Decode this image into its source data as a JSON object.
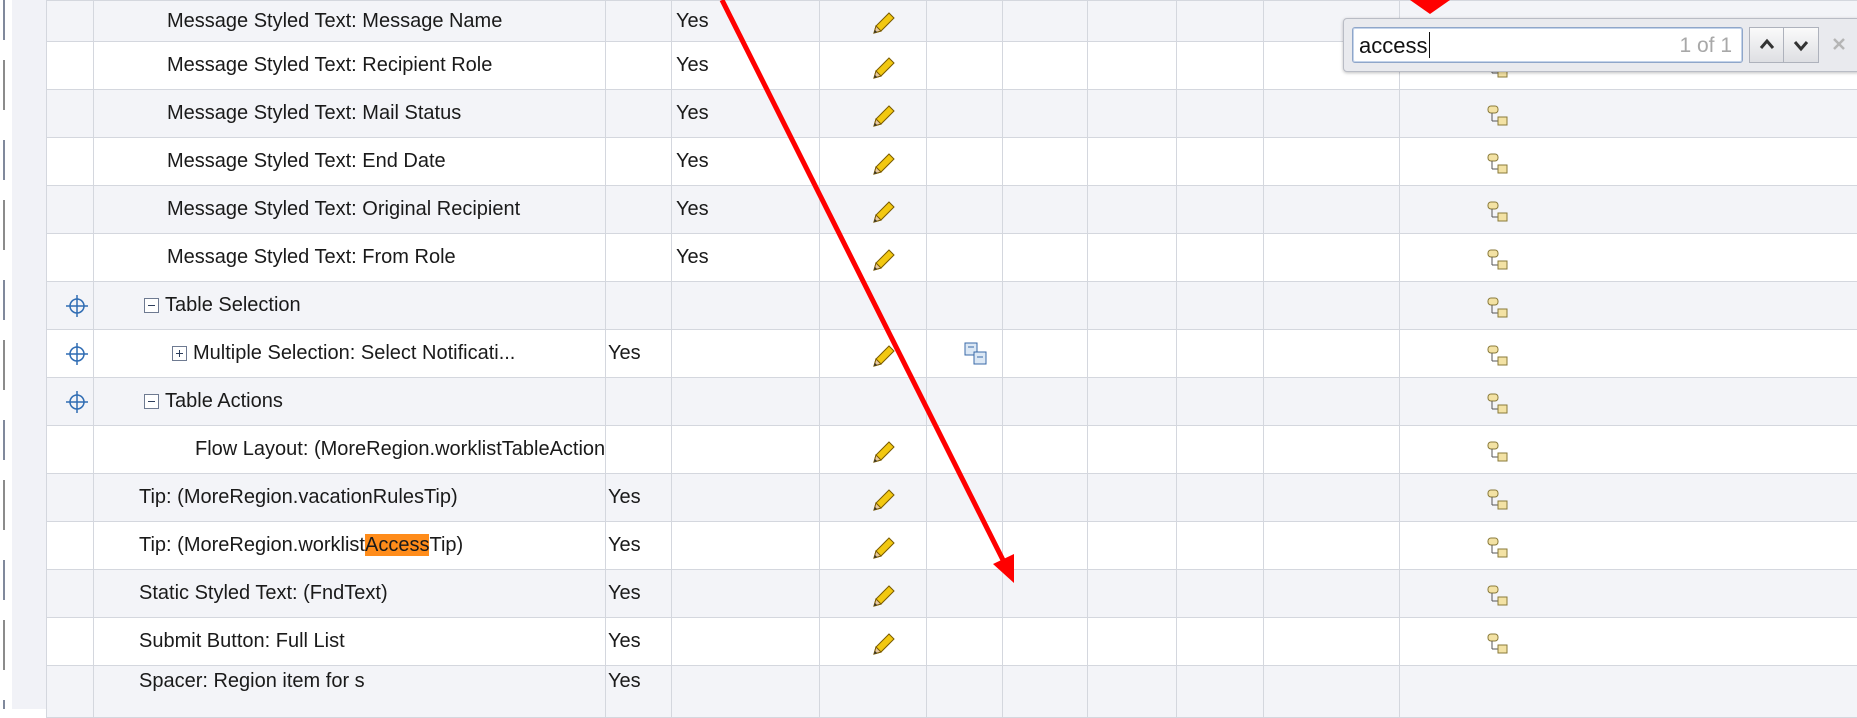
{
  "find": {
    "query": "access",
    "count": "1 of 1",
    "prev_icon": "chevron-up-icon",
    "next_icon": "chevron-down-icon",
    "close_icon": "close-icon"
  },
  "colors": {
    "match_highlight": "#ff8c1a",
    "arrow": "#ff0000",
    "row_alt": "#f3f4f8"
  },
  "rows": [
    {
      "item": "Message Styled Text: Message Name",
      "col3": "Yes"
    },
    {
      "item": "Message Styled Text: Recipient Role",
      "col3": "Yes"
    },
    {
      "item": "Message Styled Text: Mail Status",
      "col3": "Yes"
    },
    {
      "item": "Message Styled Text: End Date",
      "col3": "Yes"
    },
    {
      "item": "Message Styled Text: Original Recipient",
      "col3": "Yes"
    },
    {
      "item": "Message Styled Text: From Role",
      "col3": "Yes"
    },
    {
      "item": "Table Selection",
      "toggle": "collapse"
    },
    {
      "item": "Multiple Selection: Select Notificati...",
      "toggle": "expand",
      "col2": "Yes"
    },
    {
      "item": "Table Actions",
      "toggle": "collapse"
    },
    {
      "item": "Flow Layout: (MoreRegion.worklistTableActions)"
    },
    {
      "item": "Tip: (MoreRegion.vacationRulesTip)",
      "col2": "Yes"
    },
    {
      "item_pre": "Tip: (MoreRegion.worklist",
      "item_match": "Access",
      "item_post": "Tip)",
      "col2": "Yes"
    },
    {
      "item": "Static Styled Text: (FndText)",
      "col2": "Yes"
    },
    {
      "item": "Submit Button: Full List",
      "col2": "Yes"
    },
    {
      "item": "Spacer: Region item for s",
      "col2": "Yes"
    }
  ]
}
